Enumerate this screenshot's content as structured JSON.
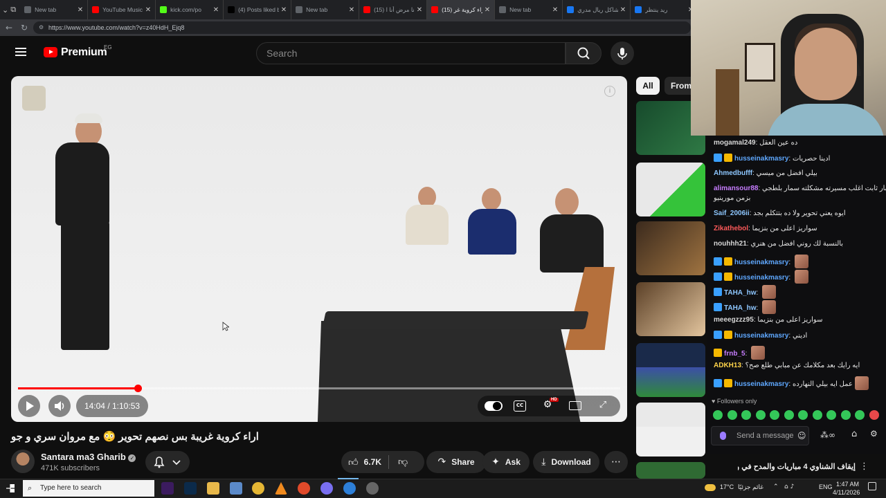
{
  "browser": {
    "tabs": [
      {
        "label": "New tab"
      },
      {
        "label": "YouTube Music"
      },
      {
        "label": "kick.com/po"
      },
      {
        "label": "(4) Posts liked by"
      },
      {
        "label": "New tab"
      },
      {
        "label": "(15) أنا مرض أنا ا..."
      },
      {
        "label": "(15) اراء كروية غر",
        "active": true
      },
      {
        "label": "New tab"
      },
      {
        "label": "مشاكل ريال مدري"
      },
      {
        "label": "ريد ينتظر"
      }
    ],
    "url": "https://www.youtube.com/watch?v=z40HdH_Ejq8"
  },
  "header": {
    "logo_text": "Premium",
    "region": "EG",
    "search_placeholder": "Search"
  },
  "player": {
    "current_time": "14:04",
    "separator": " / ",
    "duration": "1:10:53",
    "progress_fraction": 0.199,
    "hd_badge": "HD"
  },
  "video": {
    "title": "اراء كروية غريبة بس نصهم تحوير 😳 مع مروان سري و جو",
    "channel": "Santara ma3 Gharib",
    "subscribers": "471K subscribers",
    "likes": "6.7K",
    "share": "Share",
    "ask": "Ask",
    "download": "Download"
  },
  "sidebar": {
    "chip_all": "All",
    "chip_from": "From",
    "bottom_video_title": "إيقاف الشناوي 4 مباريات والمدح في وفا و"
  },
  "chat": {
    "messages": [
      {
        "user": "mogamal249",
        "text": "ده عين العقل",
        "color": "#d7d7d7"
      },
      {
        "user": "husseinakmasry",
        "text": "ادينا حصريات",
        "color": "#5fa8ff",
        "badges": true
      },
      {
        "user": "Ahmedbufff",
        "text": "بيلي افضل من ميسي",
        "color": "#8ec7ff"
      },
      {
        "user": "alimansour88",
        "text": "دفاعيا جبار ثابت اغلب مسيرته مشكلته سمار بلطجي",
        "text2": "بزمن مورينيو",
        "color": "#c77dff"
      },
      {
        "user": "Saif_2006ii",
        "text": "ايوه يعني تحوير ولا ده بتتكلم بجد",
        "color": "#8ec7ff"
      },
      {
        "user": "Zikathebol",
        "text": "سواريز اعلى من بنزيما",
        "color": "#ff5a5a"
      },
      {
        "user": "nouhhh21",
        "text": "بالنسبة لك روني افضل من هنري",
        "color": "#d7d7d7"
      },
      {
        "user": "husseinakmasry",
        "text": "",
        "color": "#5fa8ff",
        "badges": true,
        "emote": true
      },
      {
        "user": "husseinakmasry",
        "text": "",
        "color": "#5fa8ff",
        "badges": true,
        "emote": true
      },
      {
        "user": "TAHA_hw",
        "text": "",
        "color": "#8ec7ff",
        "badge1": true,
        "emote": true
      },
      {
        "user": "TAHA_hw",
        "text": "",
        "color": "#8ec7ff",
        "badge1": true,
        "emote": true
      },
      {
        "user": "meeegzzz95",
        "text": "سواريز اعلى من بنزيما",
        "color": "#d7d7d7"
      },
      {
        "user": "husseinakmasry",
        "text": "اديني",
        "color": "#5fa8ff",
        "badges": true
      },
      {
        "user": "frnb_5",
        "text": "",
        "color": "#c77dff",
        "badge2": true,
        "emote": true
      },
      {
        "user": "ADKH13",
        "text": "ايه رايك بعد مكلامك عن مبابي طلع صح؟",
        "color": "#ffd44a"
      },
      {
        "user": "husseinakmasry",
        "text": "عمل ايه بيلي النهارده",
        "color": "#5fa8ff",
        "badges": true,
        "emote": true
      }
    ],
    "followers_only": "Followers only",
    "input_placeholder": "Send a message"
  },
  "taskbar": {
    "search_placeholder": "Type here to search",
    "weather_temp": "17°C",
    "weather_text": "غائم جزئيًا",
    "lang": "ENG",
    "time": "1:47 AM",
    "date": "4/11/2026"
  }
}
